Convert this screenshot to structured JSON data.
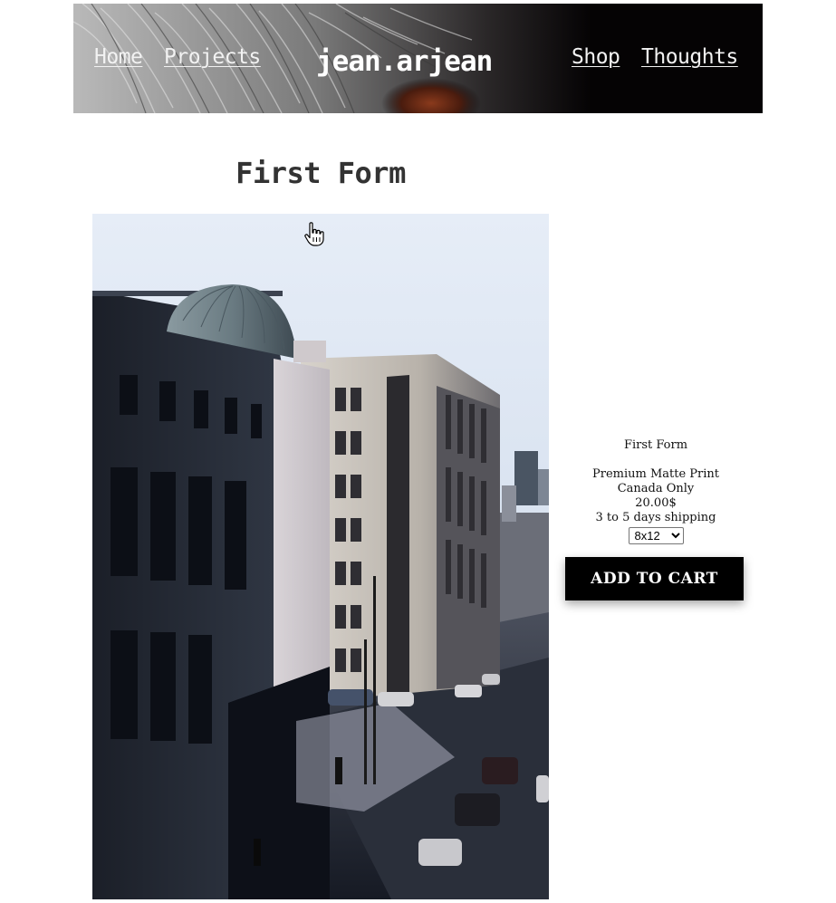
{
  "header": {
    "brand": "jean.arjean",
    "nav": {
      "home": "Home",
      "projects": "Projects",
      "shop": "Shop",
      "thoughts": "Thoughts"
    }
  },
  "product": {
    "title": "First Form",
    "info_title": "First Form",
    "print_type": "Premium Matte Print",
    "region": "Canada Only",
    "price": "20.00$",
    "shipping": "3 to 5 days shipping",
    "size_selected": "8x12",
    "add_to_cart": "ADD TO CART"
  },
  "icons": {
    "cursor": "hand-pointer-icon"
  }
}
